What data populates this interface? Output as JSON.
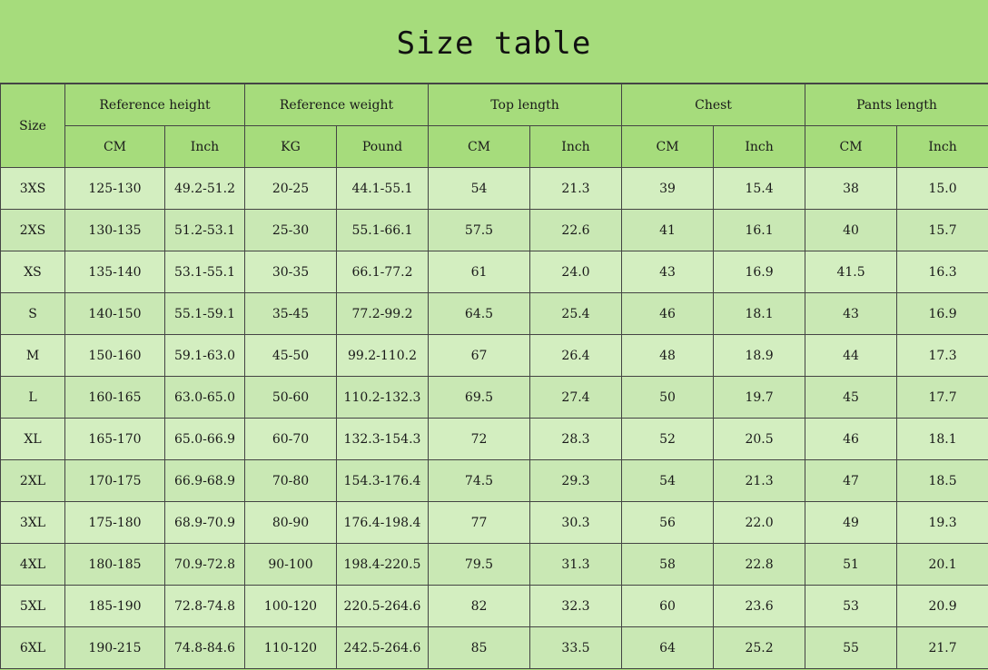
{
  "title": "Size table",
  "header": {
    "size": "Size",
    "groups": [
      "Reference height",
      "Reference weight",
      "Top length",
      "Chest",
      "Pants length"
    ],
    "units": [
      "CM",
      "Inch",
      "KG",
      "Pound",
      "CM",
      "Inch",
      "CM",
      "Inch",
      "CM",
      "Inch"
    ]
  },
  "rows": [
    [
      "3XS",
      "125-130",
      "49.2-51.2",
      "20-25",
      "44.1-55.1",
      "54",
      "21.3",
      "39",
      "15.4",
      "38",
      "15.0"
    ],
    [
      "2XS",
      "130-135",
      "51.2-53.1",
      "25-30",
      "55.1-66.1",
      "57.5",
      "22.6",
      "41",
      "16.1",
      "40",
      "15.7"
    ],
    [
      "XS",
      "135-140",
      "53.1-55.1",
      "30-35",
      "66.1-77.2",
      "61",
      "24.0",
      "43",
      "16.9",
      "41.5",
      "16.3"
    ],
    [
      "S",
      "140-150",
      "55.1-59.1",
      "35-45",
      "77.2-99.2",
      "64.5",
      "25.4",
      "46",
      "18.1",
      "43",
      "16.9"
    ],
    [
      "M",
      "150-160",
      "59.1-63.0",
      "45-50",
      "99.2-110.2",
      "67",
      "26.4",
      "48",
      "18.9",
      "44",
      "17.3"
    ],
    [
      "L",
      "160-165",
      "63.0-65.0",
      "50-60",
      "110.2-132.3",
      "69.5",
      "27.4",
      "50",
      "19.7",
      "45",
      "17.7"
    ],
    [
      "XL",
      "165-170",
      "65.0-66.9",
      "60-70",
      "132.3-154.3",
      "72",
      "28.3",
      "52",
      "20.5",
      "46",
      "18.1"
    ],
    [
      "2XL",
      "170-175",
      "66.9-68.9",
      "70-80",
      "154.3-176.4",
      "74.5",
      "29.3",
      "54",
      "21.3",
      "47",
      "18.5"
    ],
    [
      "3XL",
      "175-180",
      "68.9-70.9",
      "80-90",
      "176.4-198.4",
      "77",
      "30.3",
      "56",
      "22.0",
      "49",
      "19.3"
    ],
    [
      "4XL",
      "180-185",
      "70.9-72.8",
      "90-100",
      "198.4-220.5",
      "79.5",
      "31.3",
      "58",
      "22.8",
      "51",
      "20.1"
    ],
    [
      "5XL",
      "185-190",
      "72.8-74.8",
      "100-120",
      "220.5-264.6",
      "82",
      "32.3",
      "60",
      "23.6",
      "53",
      "20.9"
    ],
    [
      "6XL",
      "190-215",
      "74.8-84.6",
      "110-120",
      "242.5-264.6",
      "85",
      "33.5",
      "64",
      "25.2",
      "55",
      "21.7"
    ]
  ],
  "colors": {
    "header_bg": "#a6dc7c",
    "row_bg_odd": "#d3eec0",
    "row_bg_even": "#c9e8b4",
    "border": "#444444"
  }
}
